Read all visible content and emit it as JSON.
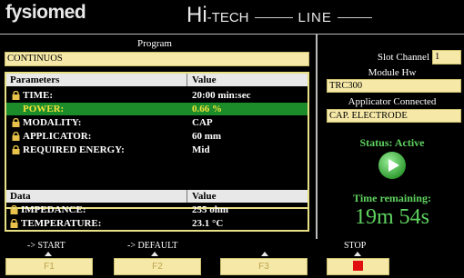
{
  "header": {
    "logo": "fysiomed",
    "brand_hi": "Hi",
    "brand_tech": "-TECH",
    "brand_line": "LINE"
  },
  "program": {
    "label": "Program",
    "value": "CONTINUOS"
  },
  "parameters": {
    "col_param": "Parameters",
    "col_value": "Value",
    "rows": [
      {
        "label": "TIME:",
        "value": "20:00 min:sec"
      },
      {
        "label": "POWER:",
        "value": "0.66 %"
      },
      {
        "label": "MODALITY:",
        "value": "CAP"
      },
      {
        "label": "APPLICATOR:",
        "value": "60 mm"
      },
      {
        "label": "REQUIRED ENERGY:",
        "value": "Mid"
      }
    ]
  },
  "data_section": {
    "col_param": "Data",
    "col_value": "Value",
    "rows": [
      {
        "label": "IMPEDANCE:",
        "value": "255 ohm"
      },
      {
        "label": "TEMPERATURE:",
        "value": "23.1 °C"
      }
    ]
  },
  "right": {
    "slot_channel_label": "Slot Channel",
    "slot_channel_value": "1",
    "module_label": "Module Hw",
    "module_value": "TRC300",
    "applicator_label": "Applicator Connected",
    "applicator_value": "CAP. ELECTRODE",
    "status": "Status: Active",
    "time_label": "Time remaining:",
    "time_value": "19m 54s"
  },
  "softkeys": {
    "start_hint": "-> START",
    "default_hint": "-> DEFAULT",
    "stop_hint": "STOP",
    "f1": "F1",
    "f2": "F2",
    "f3": "F3"
  },
  "colors": {
    "field": "#f6e9a8",
    "selected_row": "#1b8c29",
    "status_green": "#5fd35f",
    "play_green": "#4fc24f",
    "stop_red": "#e01010"
  }
}
